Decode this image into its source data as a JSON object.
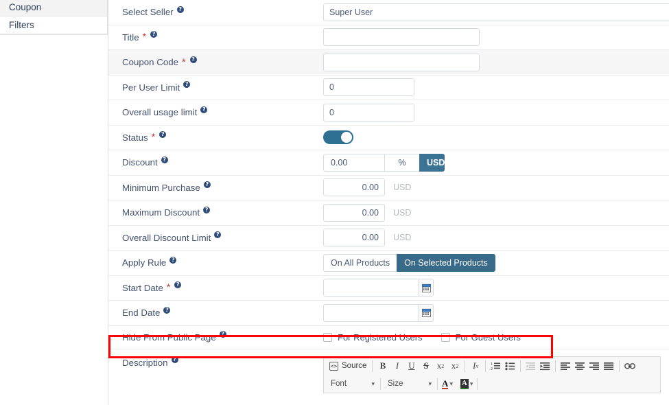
{
  "sidebar": {
    "items": [
      {
        "label": "Coupon",
        "active": true
      },
      {
        "label": "Filters",
        "active": false
      }
    ]
  },
  "form": {
    "rows": {
      "select_seller": {
        "label": "Select Seller",
        "value": "Super User",
        "help": "help-icon"
      },
      "title": {
        "label": "Title",
        "value": "",
        "required": "*",
        "help": "help-icon"
      },
      "coupon_code": {
        "label": "Coupon Code",
        "value": "",
        "required": "*",
        "help": "help-icon"
      },
      "per_user_limit": {
        "label": "Per User Limit",
        "value": "0",
        "help": "help-icon"
      },
      "overall_usage_limit": {
        "label": "Overall usage limit",
        "value": "0",
        "help": "help-icon"
      },
      "status": {
        "label": "Status",
        "required": "*",
        "help": "help-icon",
        "on": true
      },
      "discount": {
        "label": "Discount",
        "value": "0.00",
        "percent": "%",
        "currency": "USD",
        "help": "help-icon"
      },
      "minimum_purchase": {
        "label": "Minimum Purchase",
        "value": "0.00",
        "unit": "USD",
        "help": "help-icon"
      },
      "maximum_discount": {
        "label": "Maximum Discount",
        "value": "0.00",
        "unit": "USD",
        "help": "help-icon"
      },
      "overall_discount_limit": {
        "label": "Overall Discount Limit",
        "value": "0.00",
        "unit": "USD",
        "help": "help-icon"
      },
      "apply_rule": {
        "label": "Apply Rule",
        "help": "help-icon",
        "options": [
          "On All Products",
          "On Selected Products"
        ],
        "selected": "On Selected Products"
      },
      "start_date": {
        "label": "Start Date",
        "value": "",
        "required": "*",
        "help": "help-icon",
        "icon": "calendar-icon"
      },
      "end_date": {
        "label": "End Date",
        "value": "",
        "help": "help-icon",
        "icon": "calendar-icon"
      },
      "hide_from_public_page": {
        "label": "Hide From Public Page",
        "help": "help-icon",
        "checkboxes": [
          {
            "label": "For Registered Users",
            "checked": false
          },
          {
            "label": "For Guest Users",
            "checked": false
          }
        ]
      },
      "description": {
        "label": "Description",
        "help": "help-icon"
      }
    }
  },
  "editor": {
    "toolbar_row1": [
      {
        "name": "source-button",
        "label": "Source"
      },
      {
        "name": "bold-icon",
        "label": "B"
      },
      {
        "name": "italic-icon",
        "label": "I"
      },
      {
        "name": "underline-icon",
        "label": "U"
      },
      {
        "name": "strikethrough-icon",
        "label": "S"
      },
      {
        "name": "subscript-icon",
        "label": "x"
      },
      {
        "name": "superscript-icon",
        "label": "x"
      },
      {
        "name": "remove-format-icon",
        "label": "Ix"
      },
      {
        "name": "numbered-list-icon",
        "label": "1."
      },
      {
        "name": "bulleted-list-icon",
        "label": "•"
      },
      {
        "name": "decrease-indent-icon",
        "label": "<"
      },
      {
        "name": "increase-indent-icon",
        "label": ">"
      },
      {
        "name": "align-left-icon",
        "label": "left"
      },
      {
        "name": "align-center-icon",
        "label": "center"
      },
      {
        "name": "align-right-icon",
        "label": "right"
      },
      {
        "name": "align-justify-icon",
        "label": "justify"
      },
      {
        "name": "link-icon",
        "label": "link"
      }
    ],
    "toolbar_row2": {
      "font_label": "Font",
      "size_label": "Size",
      "text_color": "A",
      "bg_color": "A"
    }
  },
  "colors": {
    "accent_toggle": "#2d7094",
    "accent_currency": "#3a7394",
    "accent_selected": "#3a6a8a",
    "label_text": "#45536e",
    "required": "#cf3030",
    "highlight_box": "#fb0000",
    "row_shaded": "#f6f6f7"
  }
}
